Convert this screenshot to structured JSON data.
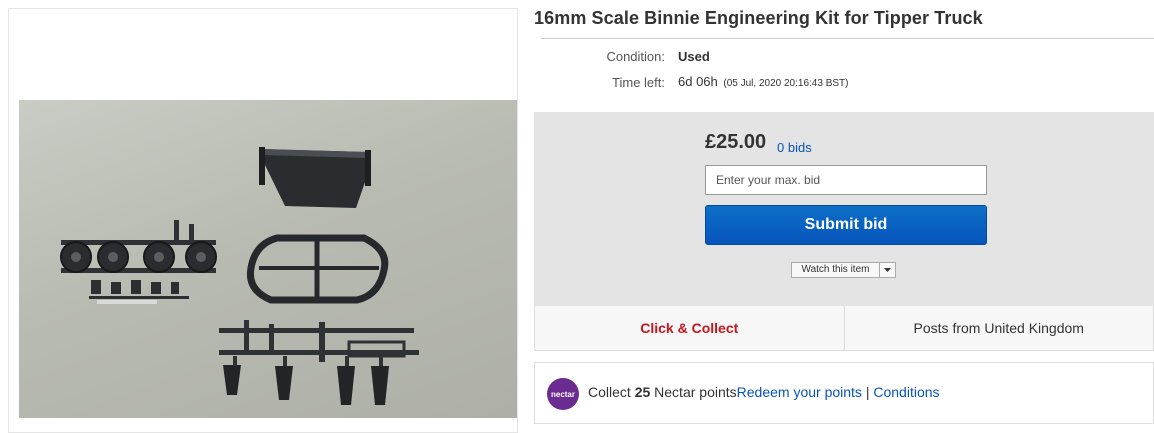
{
  "listing": {
    "title": "16mm Scale Binnie Engineering Kit for Tipper Truck",
    "condition_label": "Condition:",
    "condition_value": "Used",
    "time_left_label": "Time left:",
    "time_left_value": "6d 06h",
    "end_time": "(05 Jul, 2020  20:16:43 BST)"
  },
  "bid": {
    "price": "£25.00",
    "bids_link": "0 bids",
    "input_placeholder": "Enter your max. bid",
    "submit_label": "Submit bid",
    "watch_label": "Watch this item",
    "watch_icon": "caret-down-icon"
  },
  "delivery": {
    "click_collect": "Click & Collect",
    "posts_from": "Posts from United Kingdom"
  },
  "nectar": {
    "logo_text": "nectar",
    "prefix": "Collect ",
    "points": "25",
    "suffix": " Nectar points",
    "redeem_link": "Redeem your points",
    "separator": " | ",
    "conditions_link": "Conditions"
  },
  "colors": {
    "link_blue": "#0654ba",
    "button_blue": "#0654ba",
    "collect_red": "#c4161c",
    "nectar_purple": "#6b2c91",
    "bidbox_grey": "#e4e4e4"
  }
}
